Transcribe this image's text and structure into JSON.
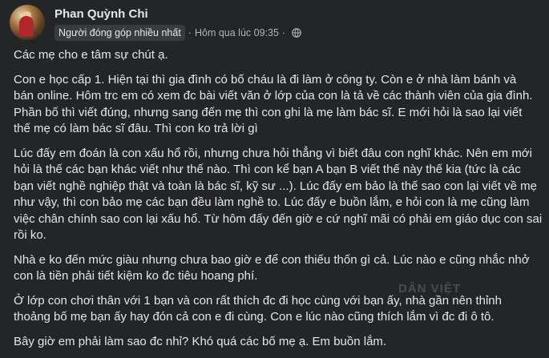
{
  "post": {
    "author": "Phan Quỳnh Chi",
    "badge": "Người đóng góp nhiều nhất",
    "separator": "·",
    "time": "Hôm qua lúc 09:35",
    "privacy_icon": "globe-icon",
    "paragraphs": [
      "Các mẹ cho e tâm sự chút ạ.",
      "Con e học cấp 1. Hiện tại thì gia đình có bố cháu là đi làm ở công ty. Còn e ở nhà làm bánh và\nbán online. Hôm trc em có xem đc bài viết văn ở lớp của con là tả về các thành viên của gia đình.\nPhần bố thì viết đúng, nhưng sang đến mẹ thì con ghi là mẹ làm bác sĩ. E mới hỏi là sao lại viết\nthế mẹ có làm bác sĩ đâu. Thì con ko trả lời gì",
      "Lúc đấy em đoán là con xấu hổ rồi, nhưng chưa hỏi thẳng vì biết đâu con nghĩ khác. Nên em mới\nhỏi là thế các bạn khác viết như thế nào. Thì con kể bạn A bạn B viết thế này thế kia (tức là các\nbạn viết nghề nghiệp thật và toàn là bác sĩ, kỹ sư ...). Lúc đấy em bảo là thế sao con lại viết về mẹ\nnhư vậy, thì con bảo mẹ các bạn đều làm nghề to. Lúc đấy e buồn lắm, e hỏi con là mẹ cũng làm\nviệc chân chính sao con lại xấu hổ. Từ hôm đấy đến giờ e cứ nghĩ mãi có phải em giáo dục con sai\nrồi ko.",
      "Nhà e ko đến mức giàu nhưng chưa bao giờ e để con thiếu thốn gì cả. Lúc nào e cũng nhắc nhở\ncon là tiền phải tiết kiệm ko đc tiêu hoang phí.",
      "Ở lớp con chơi thân với 1 bạn và con rất thích đc đi học cùng với bạn ấy, nhà gần nên thỉnh\nthoảng bố mẹ bạn ấy hay đón cả con e đi cùng. Con e lúc nào cũng thích lắm vì đc đi ô tô.",
      "Bây giờ em phải làm sao đc nhỉ? Khó quá các bố mẹ ạ. Em buồn lắm."
    ],
    "watermark": "DÂN VIỆT"
  },
  "colors": {
    "background": "#242526",
    "text": "#e4e6eb",
    "secondary_text": "#b0b3b8",
    "badge_bg": "#3a3b3c"
  }
}
